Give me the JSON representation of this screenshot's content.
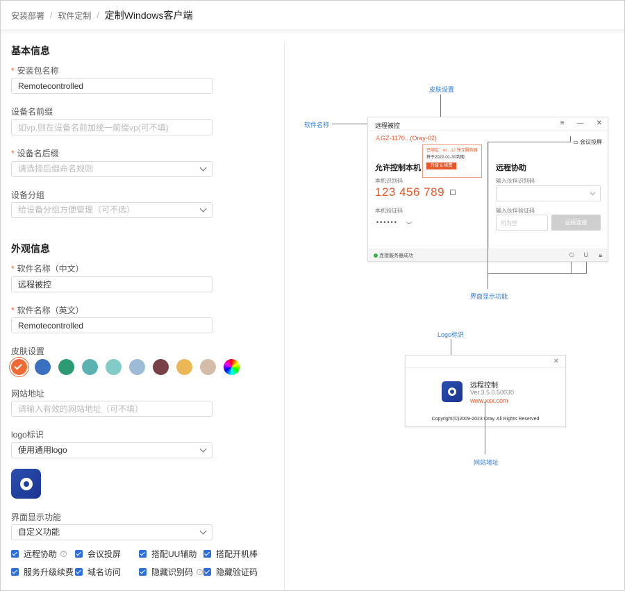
{
  "breadcrumb": {
    "item1": "安装部署",
    "item2": "软件定制",
    "current": "定制Windows客户端",
    "separator": "/"
  },
  "basic": {
    "title": "基本信息",
    "package_label": "安装包名称",
    "package_value": "Remotecontrolled",
    "prefix_label": "设备名前缀",
    "prefix_placeholder": "如vp,则在设备名前加统一前缀vp(可不填)",
    "suffix_label": "设备名后缀",
    "suffix_placeholder": "请选择后缀命名规则",
    "group_label": "设备分组",
    "group_placeholder": "给设备分组方便管理（可不选）",
    "required_mark": "*"
  },
  "appearance": {
    "title": "外观信息",
    "name_cn_label": "软件名称（中文）",
    "name_cn_value": "远程被控",
    "name_en_label": "软件名称（英文）",
    "name_en_value": "Remotecontrolled",
    "skin_label": "皮肤设置",
    "skin_colors": [
      "#f06a35",
      "#3b6fc0",
      "#2c9a72",
      "#5bb2b0",
      "#82cbc6",
      "#9dbad6",
      "#7a4048",
      "#ecb857",
      "#d3bca8",
      "rainbow"
    ],
    "skin_selected": 0,
    "site_label": "网站地址",
    "site_placeholder": "请输入有效的网站地址（可不填）",
    "logo_label": "logo标识",
    "logo_value": "使用通用logo",
    "ui_label": "界面显示功能",
    "ui_value": "自定义功能"
  },
  "features": [
    {
      "label": "远程协助",
      "checked": true,
      "help": true
    },
    {
      "label": "会议投屏",
      "checked": true,
      "help": false
    },
    {
      "label": "搭配UU辅助",
      "checked": true,
      "help": false
    },
    {
      "label": "搭配开机棒",
      "checked": true,
      "help": false
    },
    {
      "label": "服务升级续费",
      "checked": true,
      "help": false
    },
    {
      "label": "域名访问",
      "checked": true,
      "help": false
    },
    {
      "label": "隐藏识别码",
      "checked": true,
      "help": true
    },
    {
      "label": "隐藏验证码",
      "checked": true,
      "help": false
    }
  ],
  "preview": {
    "ann_skin": "皮肤设置",
    "ann_name": "软件名称",
    "ann_ui": "界面显示功能",
    "ann_logo": "Logo标识",
    "ann_site": "网站地址",
    "window": {
      "title": "远程被控",
      "device": "GZ-1170...(Oray-02)",
      "meeting": "会议投屏",
      "popup_line1": "已绑定：oc...12 独立服务器",
      "popup_line2": "将于2022-01-30到期",
      "popup_btn": "升级 & 续费",
      "allow_title": "允许控制本机",
      "id_label": "本机识别码",
      "id_value": "123 456 789",
      "code_label": "本机验证码",
      "code_value": "••••••",
      "remote_title": "远程协助",
      "partner_id_label": "输入伙伴识别码",
      "partner_code_label": "输入伙伴验证码",
      "partner_code_placeholder": "可为空",
      "connect_btn": "远程连接",
      "status": "连接服务器成功"
    },
    "about": {
      "name": "远程控制",
      "version": "Ver.3.5.0.50030",
      "site": "www.xxx.com",
      "copyright": "Copyright(©)2009-2023 Oray. All Rights Reserved"
    }
  }
}
